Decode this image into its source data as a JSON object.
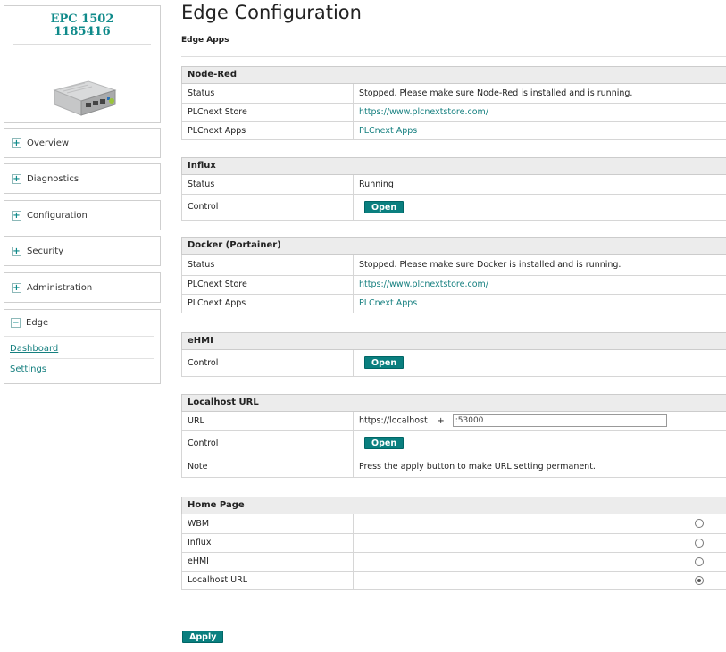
{
  "device": {
    "model": "EPC 1502",
    "serial": "1185416"
  },
  "nav": {
    "overview": "Overview",
    "diagnostics": "Diagnostics",
    "configuration": "Configuration",
    "security": "Security",
    "administration": "Administration",
    "edge": "Edge",
    "edge_dashboard": "Dashboard",
    "edge_settings": "Settings"
  },
  "page": {
    "title": "Edge Configuration",
    "subtitle": "Edge Apps"
  },
  "nodered": {
    "title": "Node-Red",
    "status_label": "Status",
    "status_value": "Stopped. Please make sure Node-Red is installed and is running.",
    "store_label": "PLCnext Store",
    "store_link": "https://www.plcnextstore.com/",
    "apps_label": "PLCnext Apps",
    "apps_link": "PLCnext Apps"
  },
  "influx": {
    "title": "Influx",
    "status_label": "Status",
    "status_value": "Running",
    "control_label": "Control",
    "open_label": "Open"
  },
  "docker": {
    "title": "Docker (Portainer)",
    "status_label": "Status",
    "status_value": "Stopped. Please make sure Docker is installed and is running.",
    "store_label": "PLCnext Store",
    "store_link": "https://www.plcnextstore.com/",
    "apps_label": "PLCnext Apps",
    "apps_link": "PLCnext Apps"
  },
  "ehmi": {
    "title": "eHMI",
    "control_label": "Control",
    "open_label": "Open"
  },
  "localhost": {
    "title": "Localhost URL",
    "url_label": "URL",
    "url_prefix": "https://localhost",
    "plus": "+",
    "port_value": ":53000",
    "control_label": "Control",
    "open_label": "Open",
    "note_label": "Note",
    "note_value": "Press the apply button to make URL setting permanent."
  },
  "homepage": {
    "title": "Home Page",
    "options": [
      {
        "label": "WBM",
        "selected": false
      },
      {
        "label": "Influx",
        "selected": false
      },
      {
        "label": "eHMI",
        "selected": false
      },
      {
        "label": "Localhost URL",
        "selected": true
      }
    ]
  },
  "apply_label": "Apply",
  "colors": {
    "accent": "#0a7f7f",
    "link": "#157f7f",
    "header_bg": "#ececec"
  }
}
